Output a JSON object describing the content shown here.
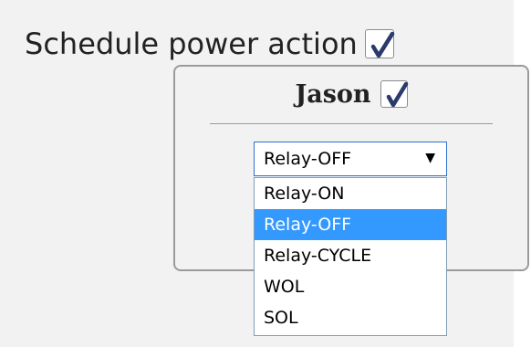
{
  "header": {
    "label": "Schedule power action",
    "checkbox_checked": true
  },
  "device": {
    "name": "Jason",
    "checkbox_checked": true
  },
  "select": {
    "value": "Relay-OFF",
    "options": [
      "Relay-ON",
      "Relay-OFF",
      "Relay-CYCLE",
      "WOL",
      "SOL"
    ],
    "highlighted_option": "Relay-OFF"
  },
  "colors": {
    "checkmark": "#2b3a6b",
    "selection": "#3399ff",
    "panel_background": "#f2f2f2",
    "select_focus_border": "#2f6fd0"
  },
  "icons": {
    "checkbox": "checkmark-icon",
    "dropdown": "caret-down-icon"
  }
}
